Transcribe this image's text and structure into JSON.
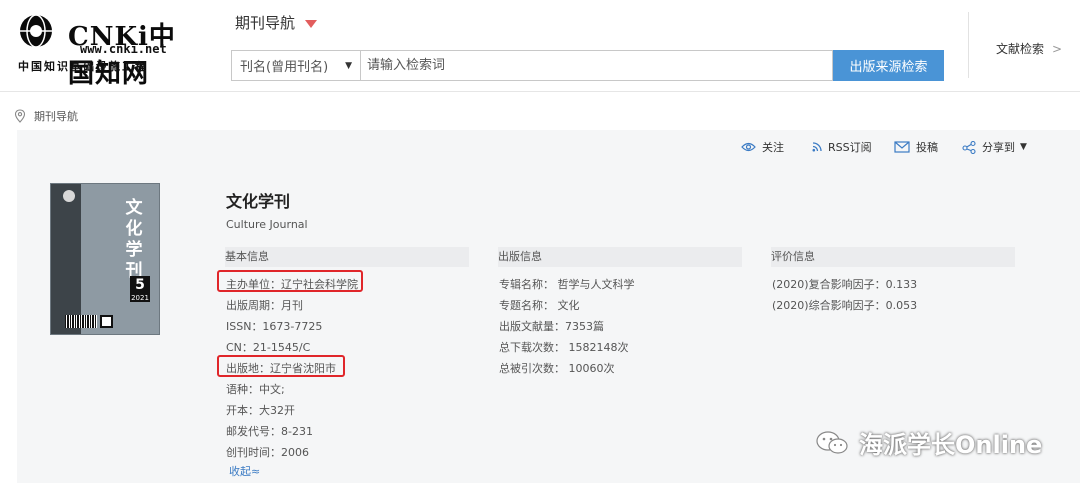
{
  "header": {
    "logo": {
      "brand": "CNKi中国知网",
      "url": "www.cnki.net",
      "slogan": "中国知识基础设施工程"
    },
    "nav_title": "期刊导航",
    "search": {
      "select_value": "刊名(曾用刊名)",
      "placeholder": "请输入检索词",
      "button_label": "出版来源检索"
    },
    "lit_search": "文献检索",
    "lit_search_arrow": ">"
  },
  "breadcrumb": {
    "label": "期刊导航"
  },
  "actions": {
    "follow": "关注",
    "rss": "RSS订阅",
    "submit": "投稿",
    "share": "分享到",
    "share_caret": "▼"
  },
  "cover": {
    "title_chars": "文化学刊",
    "issue": "5",
    "year": "2021"
  },
  "journal": {
    "title": "文化学刊",
    "english_title": "Culture Journal"
  },
  "basic_info": {
    "heading": "基本信息",
    "sponsor": "主办单位：辽宁社会科学院",
    "frequency": "出版周期：月刊",
    "issn": "ISSN：1673-7725",
    "cn": "CN：21-1545/C",
    "place": "出版地：辽宁省沈阳市",
    "language": "语种：中文;",
    "format": "开本：大32开",
    "postal_code": "邮发代号：8-231",
    "founded": "创刊时间：2006",
    "collapse": "收起≈"
  },
  "publish_info": {
    "heading": "出版信息",
    "series": "专辑名称：   哲学与人文科学",
    "topic": "专题名称：   文化",
    "doc_count": "出版文献量：7353篇",
    "downloads": "总下载次数：  1582148次",
    "citations": "总被引次数：  10060次"
  },
  "eval_info": {
    "heading": "评价信息",
    "composite_if": "(2020)复合影响因子：0.133",
    "comprehensive_if": "(2020)综合影响因子：0.053"
  },
  "watermark": {
    "text": "海派学长Online"
  },
  "colors": {
    "accent_blue": "#4a94d6",
    "highlight_red": "#e0262a",
    "caret_red": "#e25d5d",
    "link_blue": "#3b7bc4"
  }
}
